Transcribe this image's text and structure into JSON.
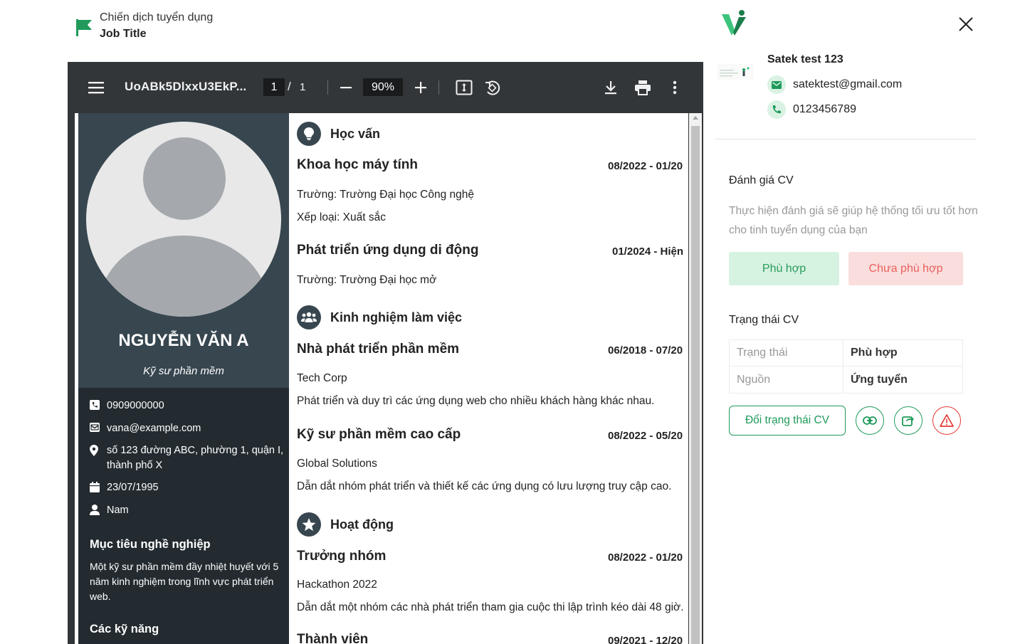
{
  "header": {
    "campaign_label": "Chiến dịch tuyển dụng",
    "job_title": "Job Title"
  },
  "pdf_viewer": {
    "file_name": "UoABk5DlxxU3EkP...",
    "current_page": "1",
    "page_separator": "/",
    "total_pages": "1",
    "zoom": "90%"
  },
  "cv": {
    "name": "NGUYỄN VĂN A",
    "role": "Kỹ sư phần mềm",
    "contact": {
      "phone": "0909000000",
      "email": "vana@example.com",
      "address_line1": "số 123 đường ABC, phường 1, quận I,",
      "address_line2": "thành phố X",
      "birthday": "23/07/1995",
      "gender": "Nam"
    },
    "objective_title": "Mục tiêu nghề nghiệp",
    "objective_lines": [
      "Một kỹ sư phần mềm đầy nhiệt huyết với 5",
      "năm kinh nghiệm trong lĩnh vực phát triển",
      "web."
    ],
    "skills_title": "Các kỹ năng",
    "education": {
      "title": "Học vấn",
      "entries": [
        {
          "title": "Khoa học máy tính",
          "date": "08/2022 - 01/20",
          "lines": [
            "Trường: Trường Đại học Công nghệ",
            "Xếp loại: Xuất sắc"
          ]
        },
        {
          "title": "Phát triển ứng dụng di động",
          "date": "01/2024 - Hiện",
          "lines": [
            "Trường: Trường Đại học mở"
          ]
        }
      ]
    },
    "experience": {
      "title": "Kinh nghiệm làm việc",
      "entries": [
        {
          "title": "Nhà phát triển phần mềm",
          "date": "06/2018 - 07/20",
          "lines": [
            "Tech Corp",
            "Phát triển và duy trì các ứng dụng web cho nhiều khách hàng khác nhau."
          ]
        },
        {
          "title": "Kỹ sư phần mềm cao cấp",
          "date": "08/2022 - 05/20",
          "lines": [
            "Global Solutions",
            "Dẫn dắt nhóm phát triển và thiết kế các ứng dụng có lưu lượng truy cập cao."
          ]
        }
      ]
    },
    "activities": {
      "title": "Hoạt động",
      "entries": [
        {
          "title": "Trưởng nhóm",
          "date": "08/2022 - 01/20",
          "lines": [
            "Hackathon 2022",
            "Dẫn dắt một nhóm các nhà phát triển tham gia cuộc thi lập trình kéo dài 48 giờ."
          ]
        },
        {
          "title": "Thành viên",
          "date": "09/2021 - 12/20",
          "lines": []
        }
      ]
    }
  },
  "candidate": {
    "name": "Satek test 123",
    "email": "satektest@gmail.com",
    "phone": "0123456789"
  },
  "evaluation": {
    "title": "Đánh giá CV",
    "hint": "Thực hiện đánh giá sẽ giúp hệ thống tối ưu tốt hơn cho tinh tuyển dụng của bạn",
    "fit_label": "Phù hợp",
    "unfit_label": "Chưa phù hợp"
  },
  "status": {
    "title": "Trạng thái CV",
    "rows": [
      {
        "key": "Trạng thái",
        "value": "Phù hợp"
      },
      {
        "key": "Nguồn",
        "value": "Ứng tuyển"
      }
    ],
    "change_label": "Đổi trạng thái CV"
  },
  "colors": {
    "brand_green": "#1f9a5a",
    "danger_red": "#e53935",
    "cv_dark": "#232b30",
    "cv_slate": "#37464f"
  },
  "icons": [
    "flag-icon",
    "menu-icon",
    "zoom-out-icon",
    "zoom-in-icon",
    "fit-page-icon",
    "rotate-icon",
    "download-icon",
    "print-icon",
    "more-icon",
    "close-icon",
    "mail-icon",
    "phone-icon",
    "link-icon",
    "share-icon",
    "warning-icon"
  ]
}
